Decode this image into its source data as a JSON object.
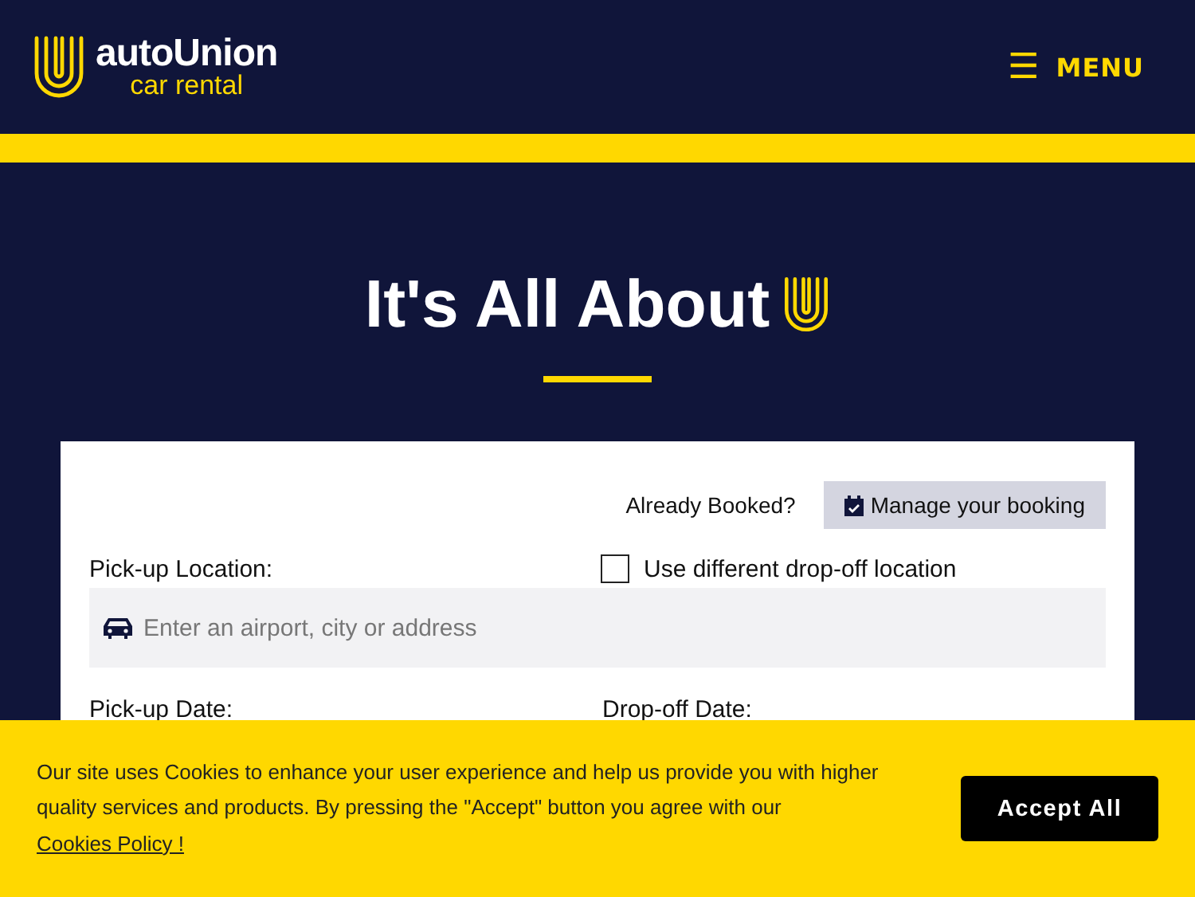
{
  "header": {
    "logo": {
      "name": "autoUnion",
      "tagline": "car rental"
    },
    "menu_button": {
      "icon": "☰",
      "label": "MENU"
    }
  },
  "hero": {
    "title": "It's All About"
  },
  "booking_form": {
    "already_booked": "Already Booked?",
    "manage_button": "Manage your booking",
    "pickup_location_label": "Pick-up Location:",
    "different_dropoff": {
      "label": "Use different drop-off location",
      "checked": false
    },
    "location_field": {
      "placeholder": "Enter an airport, city or address"
    },
    "pickup_date_label": "Pick-up Date:",
    "dropoff_date_label": "Drop-off Date:"
  },
  "cookie_banner": {
    "text": "Our site uses Cookies to enhance your user experience and help us provide you with higher quality services and products. By pressing the \"Accept\" button you agree with our",
    "link": "Cookies Policy !",
    "button": "Accept All"
  }
}
